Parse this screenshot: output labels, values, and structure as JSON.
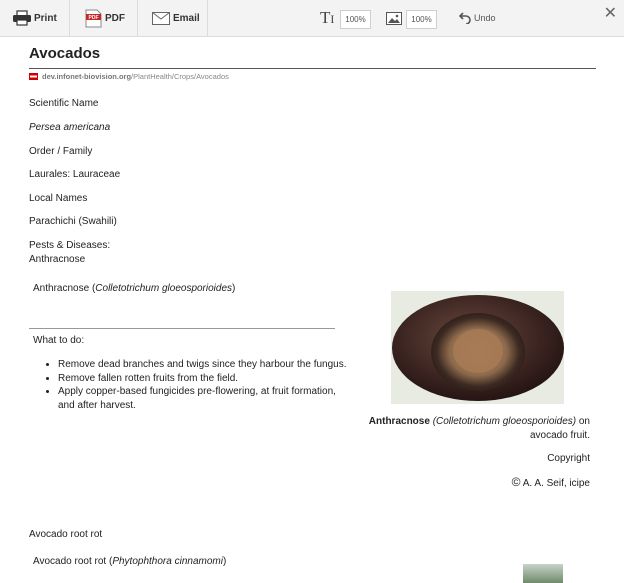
{
  "toolbar": {
    "print_label": "Print",
    "pdf_label": "PDF",
    "email_label": "Email",
    "text_zoom": "100%",
    "image_zoom": "100%",
    "undo_label": "Undo",
    "close_glyph": "✕",
    "pdf_icon_text": "PDF"
  },
  "page": {
    "title": "Avocados",
    "source_domain": "dev.infonet-biovision.org",
    "source_path": "/PlantHealth/Crops/Avocados",
    "scientific_name_label": "Scientific Name",
    "scientific_name": "Persea americana",
    "order_family_label": "Order / Family",
    "order_family": "Laurales: Lauraceae",
    "local_names_label": "Local Names",
    "local_names": "Parachichi (Swahili)",
    "pests_label": "Pests & Diseases:",
    "pest_first": "Anthracnose",
    "section1": {
      "name": "Anthracnose",
      "open": "(",
      "sci": "Colletotrichum gloeosporioides",
      "close": ")",
      "what_to_do": "What to do:",
      "items": [
        "Remove dead branches and twigs since they harbour the fungus.",
        "Remove fallen rotten fruits from the field.",
        "Apply copper-based fungicides pre-flowering, at fruit formation, and after harvest."
      ],
      "caption_bold": "Anthracnose",
      "caption_sci": "(Colletotrichum gloeosporioides)",
      "caption_rest": "on avocado fruit.",
      "copyright_label": "Copyright",
      "copyright_owner": "A. A. Seif, icipe"
    },
    "section2": {
      "heading": "Avocado root rot",
      "name": "Avocado root rot",
      "sci": "Phytophthora cinnamomi"
    }
  },
  "colors": {
    "toolbar_bg": "#f3f3f3",
    "flag_red": "#cc0000"
  }
}
